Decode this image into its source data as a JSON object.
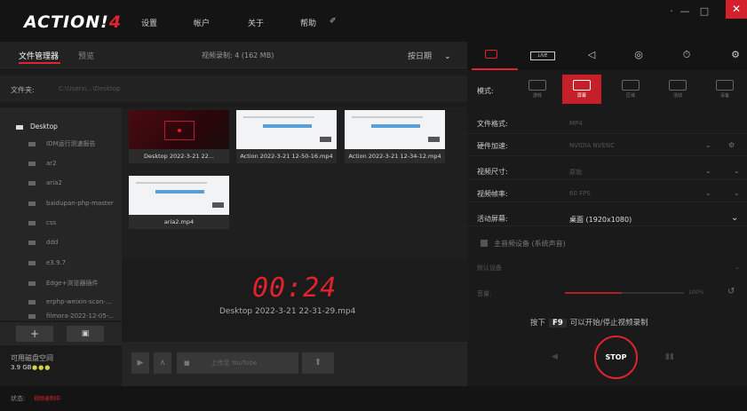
{
  "app": {
    "logo": "ACTION!",
    "logo_mark": "4",
    "menu": [
      "设置",
      "帐户",
      "关于",
      "帮助"
    ],
    "window_controls": {
      "minimize": "—",
      "restore": "□",
      "close": "✕"
    }
  },
  "left": {
    "tabs": {
      "file_manager": "文件管理器",
      "preview": "预览"
    },
    "video_info": "视频录制:  4 (162 MB)",
    "sort_label": "按日期",
    "path_label": "文件夹:",
    "path_value": "C:\\Users\\...\\Desktop",
    "tree_root": "Desktop",
    "tree_items": [
      "IDM运行测速报告",
      "ar2",
      "aria2",
      "baidupan-php-master",
      "css",
      "ddd",
      "e3.9.7",
      "Edge+浏览器插件",
      "erphp-weixin-scan-...",
      "filmora-2022-12-05-..."
    ],
    "disk_label": "可用磁盘空间",
    "disk_value": "3.9 GB",
    "thumbnails": [
      {
        "caption": "Desktop 2022-3-21 22..."
      },
      {
        "caption": "Action 2022-3-21 12-50-16.mp4"
      },
      {
        "caption": "Action 2022-3-21 12-34-12.mp4"
      },
      {
        "caption": "aria2.mp4"
      }
    ],
    "timer": "00:24",
    "recording_file": "Desktop 2022-3-21 22-31-29.mp4",
    "upload_label": "上传至 YouTube",
    "status_label": "状态:",
    "status_value": "视频录制中"
  },
  "right": {
    "live_label": "LIVE",
    "mode_label": "模式:",
    "modes": [
      "游戏",
      "屏幕",
      "区域",
      "活动",
      "设备"
    ],
    "rows": [
      {
        "label": "文件格式:",
        "value": "MP4"
      },
      {
        "label": "硬件加速:",
        "value": "NVIDIA NVENC"
      },
      {
        "label": "视频尺寸:",
        "value": "原始"
      },
      {
        "label": "视频帧率:",
        "value": "60 FPS"
      },
      {
        "label": "活动屏幕:",
        "value": "桌面 (1920x1080)"
      }
    ],
    "mic_label": "主音频设备 (系统声音)",
    "device_label": "默认设备",
    "volume_label": "音量:",
    "volume_value": "100%",
    "hint_pre": "按下",
    "hint_key": "F9",
    "hint_post": "可以开始/停止视频录制",
    "stop_label": "STOP"
  }
}
